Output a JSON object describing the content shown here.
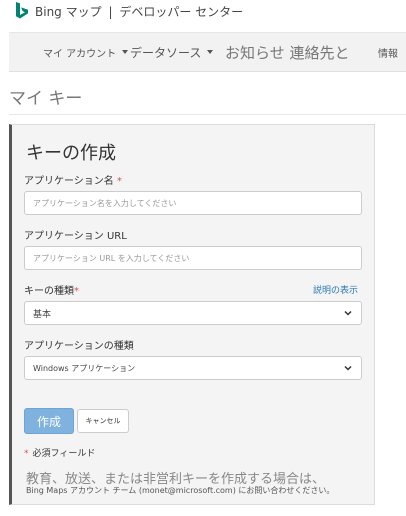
{
  "header": {
    "brand": "Bing マップ",
    "divider": "|",
    "subtitle": "デベロッパー センター"
  },
  "nav": {
    "my_account": "マイ アカウント",
    "data_sources": "データソース",
    "news": "お知らせ 連絡先と",
    "info": "情報"
  },
  "page": {
    "title": "マイ キー"
  },
  "form": {
    "title": "キーの作成",
    "app_name_label": "アプリケーション名",
    "required_mark": "*",
    "app_name_placeholder": "アプリケーション名を入力してください",
    "app_url_label": "アプリケーション URL",
    "app_url_placeholder": "アプリケーション URL を入力してください",
    "key_type_label": "キーの種類",
    "help_link": "説明の表示",
    "key_type_value": "基本",
    "app_type_label": "アプリケーションの種類",
    "app_type_value": "Windows アプリケーション",
    "create_button": "作成",
    "cancel_button": "キャンセル",
    "required_note_mark": "*",
    "required_note": "必須フィールド",
    "edu_text": "教育、放送、または非営利キーを作成する場合は、",
    "contact_prefix": "Bing Maps アカウント チーム (",
    "contact_email": "monet@microsoft.com",
    "contact_suffix": ") にお問い合わせください。"
  },
  "colors": {
    "brand_teal": "#008373",
    "create_button": "#7fb2de",
    "required_red": "#d9534f",
    "link_blue": "#2a7ab8"
  }
}
